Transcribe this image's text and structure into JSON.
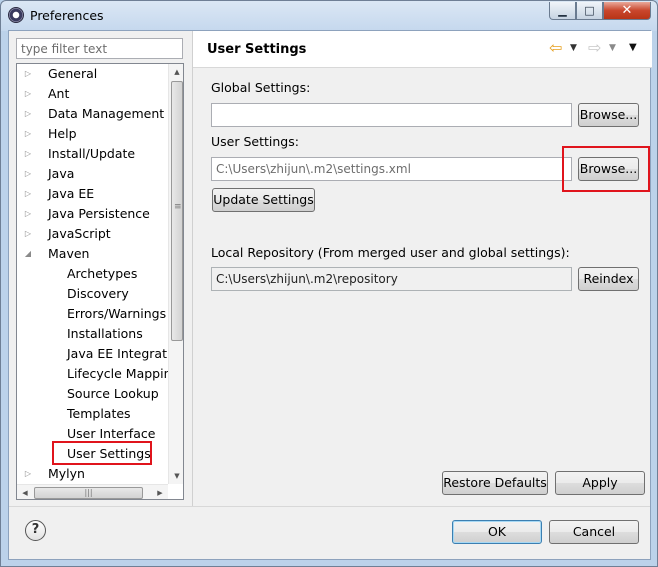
{
  "window": {
    "title": "Preferences"
  },
  "filter": {
    "placeholder": "type filter text"
  },
  "tree": {
    "items": [
      {
        "label": "General",
        "expander": "▷"
      },
      {
        "label": "Ant",
        "expander": "▷"
      },
      {
        "label": "Data Management",
        "expander": "▷"
      },
      {
        "label": "Help",
        "expander": "▷"
      },
      {
        "label": "Install/Update",
        "expander": "▷"
      },
      {
        "label": "Java",
        "expander": "▷"
      },
      {
        "label": "Java EE",
        "expander": "▷"
      },
      {
        "label": "Java Persistence",
        "expander": "▷"
      },
      {
        "label": "JavaScript",
        "expander": "▷"
      },
      {
        "label": "Maven",
        "expander": "◢"
      },
      {
        "label": "Archetypes",
        "expander": ""
      },
      {
        "label": "Discovery",
        "expander": ""
      },
      {
        "label": "Errors/Warnings",
        "expander": ""
      },
      {
        "label": "Installations",
        "expander": ""
      },
      {
        "label": "Java EE Integratior",
        "expander": ""
      },
      {
        "label": "Lifecycle Mapping",
        "expander": ""
      },
      {
        "label": "Source Lookup",
        "expander": ""
      },
      {
        "label": "Templates",
        "expander": ""
      },
      {
        "label": "User Interface",
        "expander": ""
      },
      {
        "label": "User Settings",
        "expander": "",
        "selected": true
      },
      {
        "label": "Mylyn",
        "expander": "▷"
      }
    ]
  },
  "page": {
    "title": "User Settings",
    "global_label": "Global Settings:",
    "global_value": "",
    "global_browse": "Browse...",
    "user_label": "User Settings:",
    "user_value": "C:\\Users\\zhijun\\.m2\\settings.xml",
    "user_browse": "Browse...",
    "update_button": "Update Settings",
    "local_repo_label": "Local Repository (From merged user and global settings):",
    "local_repo_value": "C:\\Users\\zhijun\\.m2\\repository",
    "reindex_button": "Reindex",
    "restore_defaults": "Restore Defaults",
    "apply": "Apply"
  },
  "footer": {
    "ok": "OK",
    "cancel": "Cancel",
    "help_glyph": "?"
  },
  "icons": {
    "back": "back-arrow-icon",
    "forward": "forward-arrow-icon",
    "dropdown": "chevron-down-icon",
    "view_menu": "view-menu-icon",
    "help": "help-icon",
    "app": "eclipse-icon"
  },
  "colors": {
    "highlight_box": "#e0141c",
    "back_arrow": "#e6a020"
  }
}
